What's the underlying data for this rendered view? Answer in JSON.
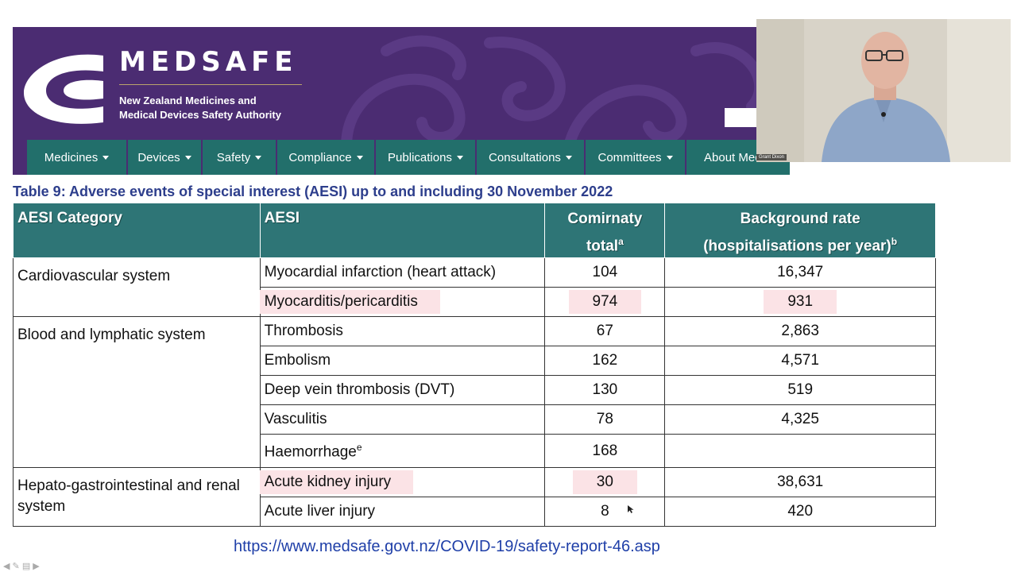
{
  "banner": {
    "brand": "MEDSAFE",
    "subtitle_line1": "New Zealand Medicines and",
    "subtitle_line2": "Medical Devices Safety Authority",
    "colors": {
      "purple": "#4b2c72",
      "nav_teal": "#226f6b"
    }
  },
  "nav": {
    "items": [
      {
        "label": "Medicines"
      },
      {
        "label": "Devices"
      },
      {
        "label": "Safety"
      },
      {
        "label": "Compliance"
      },
      {
        "label": "Publications"
      },
      {
        "label": "Consultations"
      },
      {
        "label": "Committees"
      },
      {
        "label": "About Meds"
      }
    ]
  },
  "webcam": {
    "name": "Grant Dixon"
  },
  "table": {
    "title": "Table 9: Adverse events of special interest (AESI) up to and including 30 November 2022",
    "headers": {
      "category": "AESI Category",
      "aesi": "AESI",
      "total_line1": "Comirnaty",
      "total_line2": "total",
      "total_sup": "a",
      "bg_line1": "Background rate",
      "bg_line2": "(hospitalisations per year)",
      "bg_sup": "b"
    },
    "categories": {
      "cardio": "Cardiovascular system",
      "blood": "Blood and lymphatic system",
      "hepato": "Hepato-gastrointestinal and renal system"
    },
    "rows": [
      {
        "aesi": "Myocardial infarction (heart attack)",
        "total": "104",
        "background": "16,347"
      },
      {
        "aesi": "Myocarditis/pericarditis",
        "total": "974",
        "background": "931"
      },
      {
        "aesi": "Thrombosis",
        "total": "67",
        "background": "2,863"
      },
      {
        "aesi": "Embolism",
        "total": "162",
        "background": "4,571"
      },
      {
        "aesi": "Deep vein thrombosis (DVT)",
        "total": "130",
        "background": "519"
      },
      {
        "aesi": "Vasculitis",
        "total": "78",
        "background": "4,325"
      },
      {
        "aesi": "Haemorrhage",
        "sup": "e",
        "total": "168",
        "background": ""
      },
      {
        "aesi": "Acute kidney injury",
        "total": "30",
        "background": "38,631"
      },
      {
        "aesi": "Acute liver injury",
        "total": "8",
        "background": "420"
      }
    ],
    "colors": {
      "header_teal": "#2e7576",
      "highlight": "#fbe3e6",
      "title_blue": "#2d3e8c"
    }
  },
  "source": {
    "url": "https://www.medsafe.govt.nz/COVID-19/safety-report-46.asp"
  }
}
